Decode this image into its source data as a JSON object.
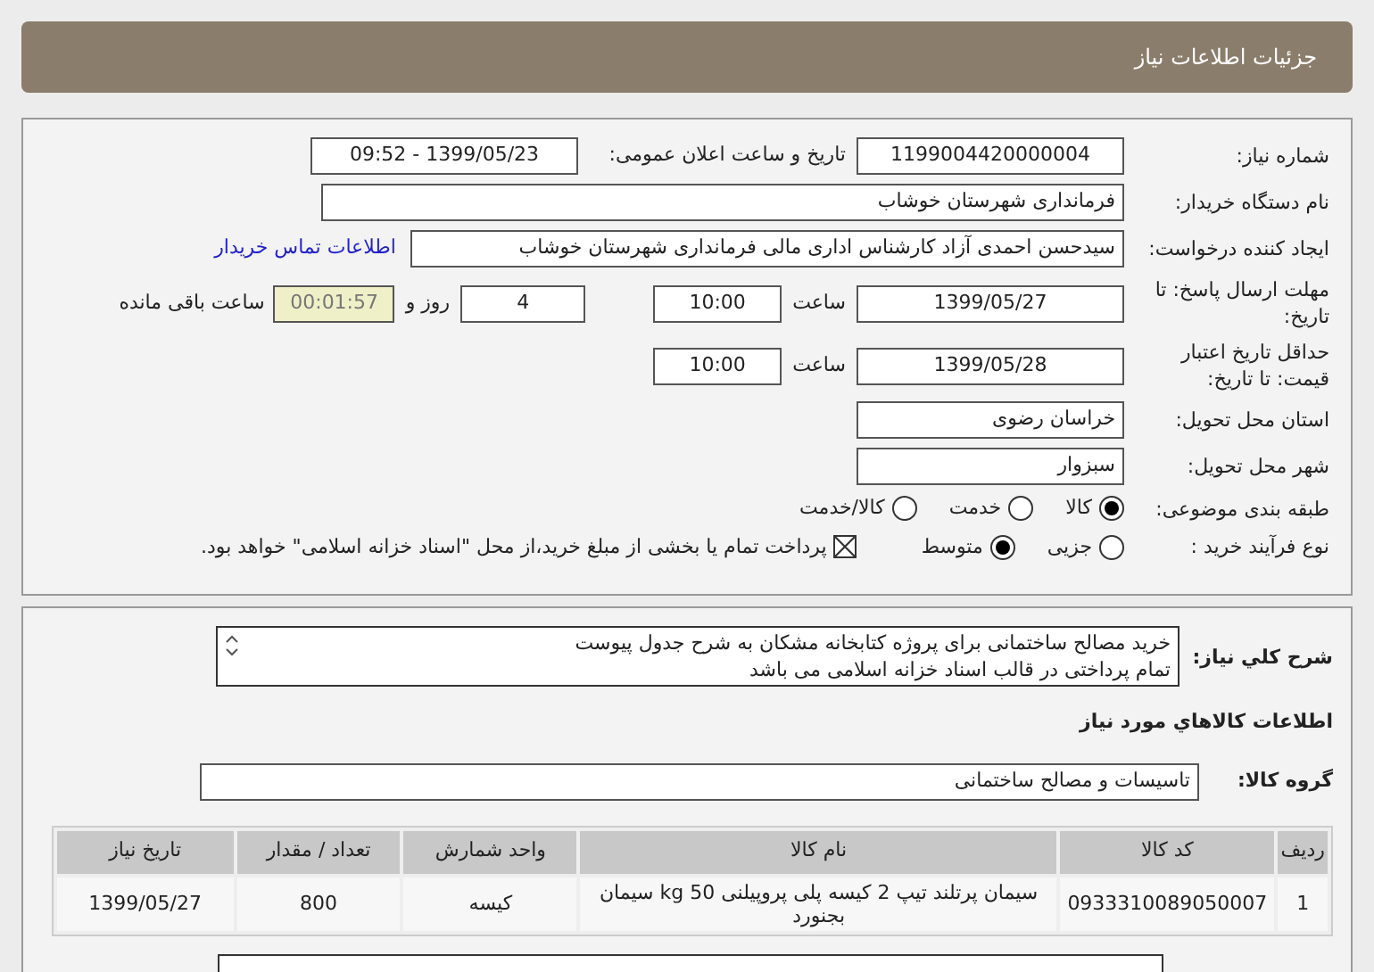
{
  "header": {
    "title": "جزئیات اطلاعات نیاز"
  },
  "details": {
    "need_number": {
      "label": "شماره نیاز:",
      "value": "1199004420000004"
    },
    "announce": {
      "label": "تاریخ و ساعت اعلان عمومی:",
      "value": "1399/05/23 - 09:52"
    },
    "buyer": {
      "label": "نام دستگاه خریدار:",
      "value": "فرمانداری شهرستان خوشاب"
    },
    "creator": {
      "label": "ایجاد کننده درخواست:",
      "value": "سیدحسن احمدی آزاد کارشناس اداری مالی فرمانداری شهرستان خوشاب",
      "link": "اطلاعات تماس خریدار"
    },
    "deadline": {
      "label": "مهلت ارسال پاسخ: تا تاریخ:",
      "date": "1399/05/27",
      "time_label": "ساعت",
      "time": "10:00",
      "days": "4",
      "days_label": "روز و",
      "remaining": "00:01:57",
      "remaining_label": "ساعت باقی مانده"
    },
    "validity": {
      "label": "حداقل تاریخ اعتبار قیمت: تا تاریخ:",
      "date": "1399/05/28",
      "time_label": "ساعت",
      "time": "10:00"
    },
    "province": {
      "label": "استان محل تحویل:",
      "value": "خراسان رضوی"
    },
    "city": {
      "label": "شهر محل تحویل:",
      "value": "سبزوار"
    },
    "category": {
      "label": "طبقه بندی موضوعی:",
      "options": [
        {
          "label": "کالا",
          "selected": true
        },
        {
          "label": "خدمت",
          "selected": false
        },
        {
          "label": "کالا/خدمت",
          "selected": false
        }
      ]
    },
    "process": {
      "label": "نوع فرآیند خرید :",
      "options": [
        {
          "label": "جزیی",
          "selected": false
        },
        {
          "label": "متوسط",
          "selected": true
        }
      ],
      "treasury": {
        "label": "پرداخت تمام یا بخشی از مبلغ خرید،از محل \"اسناد خزانه اسلامی\" خواهد بود.",
        "checked": true
      }
    }
  },
  "summary": {
    "label": "شرح کلي نياز:",
    "lines": [
      "خرید مصالح ساختمانی برای پروژه کتابخانه مشکان به شرح جدول پیوست",
      "تمام پرداختی در قالب اسناد خزانه اسلامی می باشد"
    ]
  },
  "goods_heading": "اطلاعات کالاهاي مورد نياز",
  "goods_group": {
    "label": "گروه کالا:",
    "value": "تاسیسات و مصالح ساختمانی"
  },
  "table": {
    "columns": [
      "ردیف",
      "کد کالا",
      "نام کالا",
      "واحد شمارش",
      "تعداد / مقدار",
      "تاریخ نیاز"
    ],
    "rows": [
      [
        "1",
        "0933310089050007",
        "سیمان پرتلند تیپ 2 کیسه پلی پروپیلنی 50 kg سیمان بجنورد",
        "کیسه",
        "800",
        "1399/05/27"
      ]
    ]
  }
}
